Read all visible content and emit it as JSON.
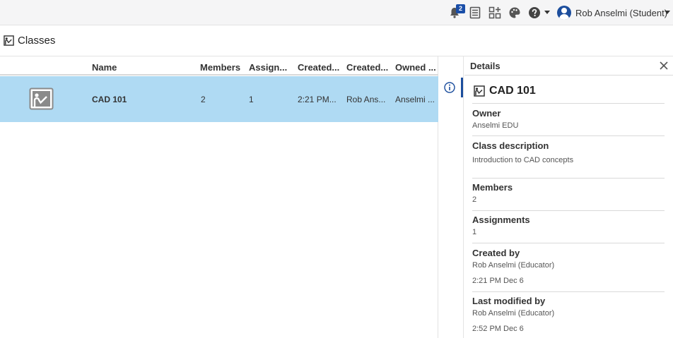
{
  "topbar": {
    "notification_count": "2",
    "user_name": "Rob Anselmi (Student)"
  },
  "page": {
    "title": "Classes"
  },
  "table": {
    "columns": [
      "Name",
      "Members",
      "Assign...",
      "Created...",
      "Created...",
      "Owned ..."
    ],
    "rows": [
      {
        "name": "CAD 101",
        "members": "2",
        "assignments": "1",
        "created": "2:21 PM...",
        "created_by": "Rob Ans...",
        "owned_by": "Anselmi ..."
      }
    ]
  },
  "details": {
    "header": "Details",
    "class_name": "CAD 101",
    "owner_label": "Owner",
    "owner_value": "Anselmi EDU",
    "description_label": "Class description",
    "description_value": "Introduction to CAD concepts",
    "members_label": "Members",
    "members_value": "2",
    "assignments_label": "Assignments",
    "assignments_value": "1",
    "created_by_label": "Created by",
    "created_by_value": "Rob Anselmi (Educator)",
    "created_date": "2:21 PM Dec 6",
    "modified_by_label": "Last modified by",
    "modified_by_value": "Rob Anselmi (Educator)",
    "modified_date": "2:52 PM Dec 6"
  },
  "colors": {
    "accent": "#1c4e9d",
    "selected_row": "#afdaf3",
    "topbar_bg": "#f5f5f6"
  },
  "icons": [
    "bell-icon",
    "task-list-icon",
    "app-grid-icon",
    "palette-icon",
    "help-icon",
    "user-avatar-icon",
    "class-icon",
    "info-icon",
    "close-icon"
  ]
}
